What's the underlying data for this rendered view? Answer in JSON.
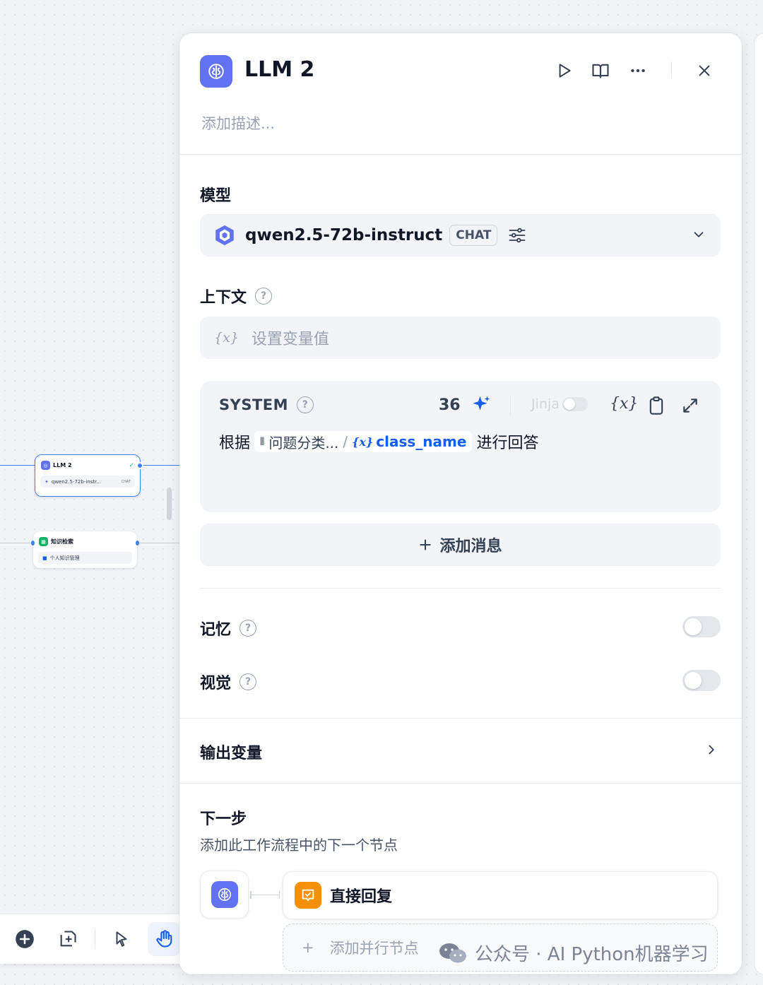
{
  "canvas": {
    "llm_node": {
      "title": "LLM 2",
      "model": "qwen2.5-72b-instr...",
      "badge": "CHAT"
    },
    "kb_node": {
      "title": "知识检索",
      "kb_name": "个人知识管理"
    }
  },
  "panel": {
    "title": "LLM 2",
    "description_placeholder": "添加描述...",
    "model_section": {
      "label": "模型",
      "model_name": "qwen2.5-72b-instruct",
      "mode_badge": "CHAT"
    },
    "context_section": {
      "label": "上下文",
      "placeholder": "设置变量值"
    },
    "system_prompt": {
      "role_label": "SYSTEM",
      "char_count": "36",
      "jinja_label": "Jinja",
      "text_before": "根据",
      "ref_node": "问题分类...",
      "ref_var": "class_name",
      "text_after": "进行回答"
    },
    "add_message_label": "添加消息",
    "memory_label": "记忆",
    "memory_enabled": false,
    "vision_label": "视觉",
    "vision_enabled": false,
    "output_vars_label": "输出变量",
    "next_step": {
      "label": "下一步",
      "description": "添加此工作流程中的下一个节点",
      "next_node_title": "直接回复",
      "add_parallel_label": "添加并行节点"
    }
  },
  "watermark": "公众号 · AI Python机器学习",
  "colors": {
    "accent": "#155eef",
    "llm_icon": "#6172f3",
    "answer_icon": "#f79009",
    "kb_icon": "#16b364"
  }
}
